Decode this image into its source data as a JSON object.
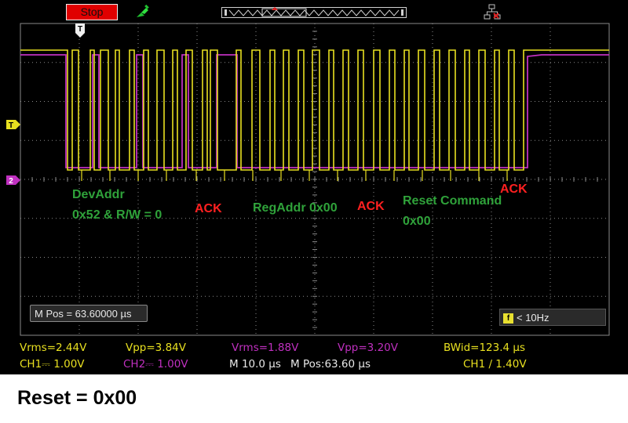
{
  "toolbar": {
    "stop_label": "Stop",
    "run_icon": "probe-icon",
    "network_icon": "network-disconnected-icon"
  },
  "markers": {
    "trigger_marker": "T",
    "ch1_marker": "T",
    "ch2_marker": "2"
  },
  "annotations": {
    "dev_addr_line1": "DevAddr",
    "dev_addr_line2": "0x52 & R/W = 0",
    "ack1": "ACK",
    "reg_addr": "RegAddr 0x00",
    "ack2": "ACK",
    "reset_cmd_line1": "Reset Command",
    "reset_cmd_line2": "0x00",
    "ack3": "ACK"
  },
  "status": {
    "m_pos_box": "M Pos = 63.60000 µs",
    "trigger_freq": "< 10Hz"
  },
  "measurements": {
    "ch1_vrms": "Vrms=2.44V",
    "ch1_vpp": "Vpp=3.84V",
    "ch2_vrms": "Vrms=1.88V",
    "ch2_vpp": "Vpp=3.20V",
    "bwid": "BWid=123.4 µs",
    "ch1_scale": "CH1⎓ 1.00V",
    "ch2_scale": "CH2⎓ 1.00V",
    "timebase": "M 10.0 µs",
    "m_pos": "M Pos:63.60 µs",
    "trigger_setting": "CH1 ∕ 1.40V"
  },
  "caption": "Reset = 0x00",
  "colors": {
    "ch1": "#e8e020",
    "ch2": "#c030c0",
    "grid": "#8a8a8a",
    "label_green": "#2fa23a",
    "label_red": "#ff2020"
  }
}
